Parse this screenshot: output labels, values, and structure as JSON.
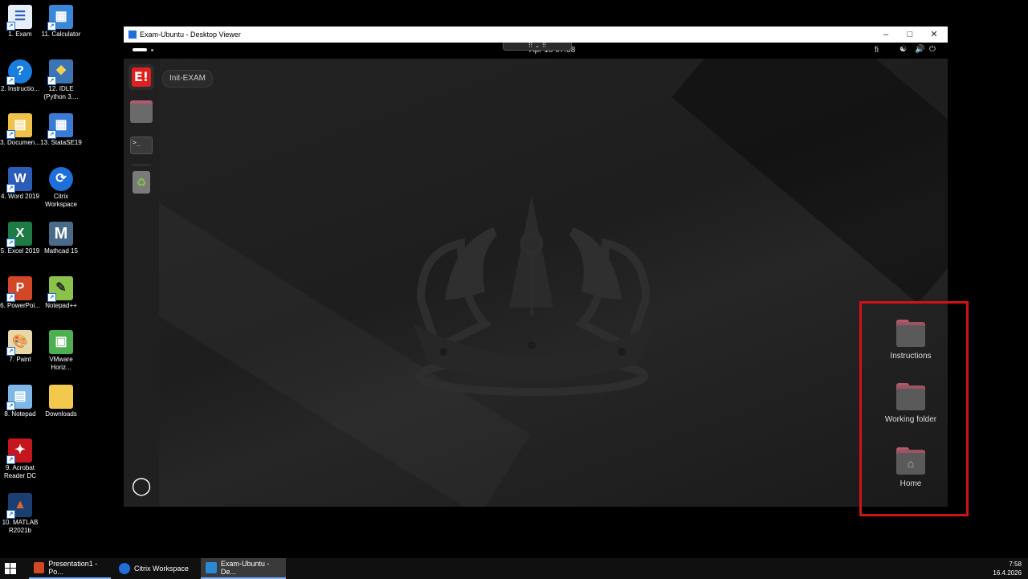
{
  "desktop_icons": [
    {
      "label": "1. Exam",
      "icon": "exam-doc-icon",
      "color": "#e8eef8"
    },
    {
      "label": "11. Calculator",
      "icon": "calculator-icon",
      "color": "#3a86d8"
    },
    {
      "label": "2. Instructio...",
      "icon": "help-icon",
      "color": "#1a7de0"
    },
    {
      "label": "12. IDLE (Python 3....",
      "icon": "python-icon",
      "color": "#3b74b5"
    },
    {
      "label": "3. Documen...",
      "icon": "documents-icon",
      "color": "#f0c24a"
    },
    {
      "label": "13. StataSE19",
      "icon": "stata-icon",
      "color": "#3a7bd5"
    },
    {
      "label": "4. Word 2019",
      "icon": "word-icon",
      "color": "#2b5cb8"
    },
    {
      "label": "Citrix Workspace",
      "icon": "citrix-icon",
      "color": "#1e6fd9"
    },
    {
      "label": "5. Excel 2019",
      "icon": "excel-icon",
      "color": "#1e7b45"
    },
    {
      "label": "Mathcad 15",
      "icon": "mathcad-icon",
      "color": "#4a6a8a"
    },
    {
      "label": "6. PowerPoi...",
      "icon": "powerpoint-icon",
      "color": "#d24726"
    },
    {
      "label": "Notepad++",
      "icon": "notepadpp-icon",
      "color": "#8bc34a"
    },
    {
      "label": "7. Paint",
      "icon": "paint-icon",
      "color": "#e8d8a8"
    },
    {
      "label": "VMware Horiz...",
      "icon": "vmware-icon",
      "color": "#4caf50"
    },
    {
      "label": "8. Notepad",
      "icon": "notepad-icon",
      "color": "#7fb8e8"
    },
    {
      "label": "Downloads",
      "icon": "folder-icon",
      "color": "#f2c94c"
    },
    {
      "label": "9. Acrobat Reader DC",
      "icon": "acrobat-icon",
      "color": "#c4161c"
    },
    {
      "label": "10. MATLAB R2021b",
      "icon": "matlab-icon",
      "color": "#e0662b"
    }
  ],
  "viewer": {
    "title": "Exam-Ubuntu - Desktop Viewer",
    "minimize": "–",
    "maximize": "□",
    "close": "✕"
  },
  "ubuntu": {
    "clock": "Apr 16  07:58",
    "keyboard_layout": "fi",
    "init_button": "Init-EXAM",
    "dock_items": [
      "exam-app-icon",
      "files-icon",
      "terminal-icon",
      "trash-icon"
    ],
    "show_apps_icon": "ubuntu-logo-icon",
    "folders": [
      {
        "label": "Instructions",
        "icon": "folder-icon"
      },
      {
        "label": "Working folder",
        "icon": "folder-icon"
      },
      {
        "label": "Home",
        "icon": "home-folder-icon"
      }
    ]
  },
  "taskbar": {
    "items": [
      {
        "label": "Presentation1 - Po...",
        "icon": "powerpoint-icon",
        "color": "#d24726"
      },
      {
        "label": "Citrix Workspace",
        "icon": "citrix-icon",
        "color": "#1e6fd9"
      },
      {
        "label": "Exam-Ubuntu - De...",
        "icon": "desktop-viewer-icon",
        "color": "#2a8ad4"
      }
    ],
    "time": "7:58",
    "date": "16.4.2026"
  },
  "colors": {
    "highlight": "#d0121b",
    "folder_tab": "#b05a6b",
    "exam_red": "#e02020"
  }
}
